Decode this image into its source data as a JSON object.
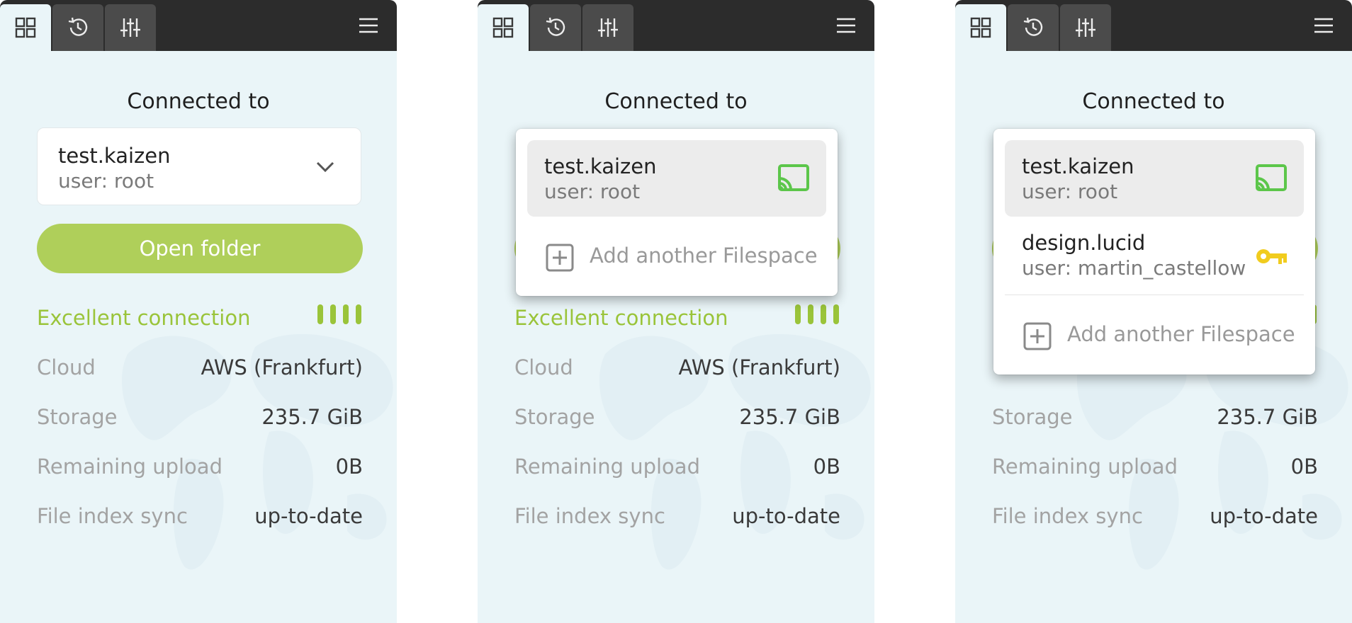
{
  "colors": {
    "topbar": "#2c2c2c",
    "panel_bg": "#eaf5f8",
    "accent_green": "#afcf5a",
    "connection_green": "#9ac43a",
    "cast_icon_green": "#5cc64a",
    "key_icon_yellow": "#f1cc1e"
  },
  "panels": [
    {
      "tabs": [
        {
          "icon": "grid-icon",
          "active": true
        },
        {
          "icon": "history-icon",
          "active": false
        },
        {
          "icon": "sliders-icon",
          "active": false
        }
      ],
      "menu_icon": "hamburger-menu-icon",
      "heading": "Connected to",
      "selector": {
        "name": "test.kaizen",
        "user": "user: root",
        "icon": "chevron-down-icon"
      },
      "open_folder": "Open folder",
      "connection": {
        "label": "Excellent connection",
        "strength": 4,
        "max_strength": 4
      },
      "info": [
        {
          "label": "Cloud",
          "value": "AWS (Frankfurt)"
        },
        {
          "label": "Storage",
          "value": "235.7 GiB"
        },
        {
          "label": "Remaining upload",
          "value": "0B"
        },
        {
          "label": "File index sync",
          "value": "up-to-date"
        }
      ]
    },
    {
      "heading": "Connected to",
      "connection": {
        "label": "Excellent connection",
        "strength": 4,
        "max_strength": 4
      },
      "info": [
        {
          "label": "Cloud",
          "value": "AWS (Frankfurt)"
        },
        {
          "label": "Storage",
          "value": "235.7 GiB"
        },
        {
          "label": "Remaining upload",
          "value": "0B"
        },
        {
          "label": "File index sync",
          "value": "up-to-date"
        }
      ],
      "dropdown": {
        "items": [
          {
            "name": "test.kaizen",
            "user": "user: root",
            "icon": "cast-icon",
            "selected": true
          }
        ],
        "add_label": "Add another Filespace",
        "add_icon": "plus-square-icon"
      }
    },
    {
      "heading": "Connected to",
      "info": [
        {
          "label": "Storage",
          "value": "235.7 GiB"
        },
        {
          "label": "Remaining upload",
          "value": "0B"
        },
        {
          "label": "File index sync",
          "value": "up-to-date"
        }
      ],
      "dropdown": {
        "items": [
          {
            "name": "test.kaizen",
            "user": "user: root",
            "icon": "cast-icon",
            "selected": true
          },
          {
            "name": "design.lucid",
            "user": "user: martin_castellow",
            "icon": "key-icon",
            "selected": false
          }
        ],
        "add_label": "Add another Filespace",
        "add_icon": "plus-square-icon"
      }
    }
  ]
}
